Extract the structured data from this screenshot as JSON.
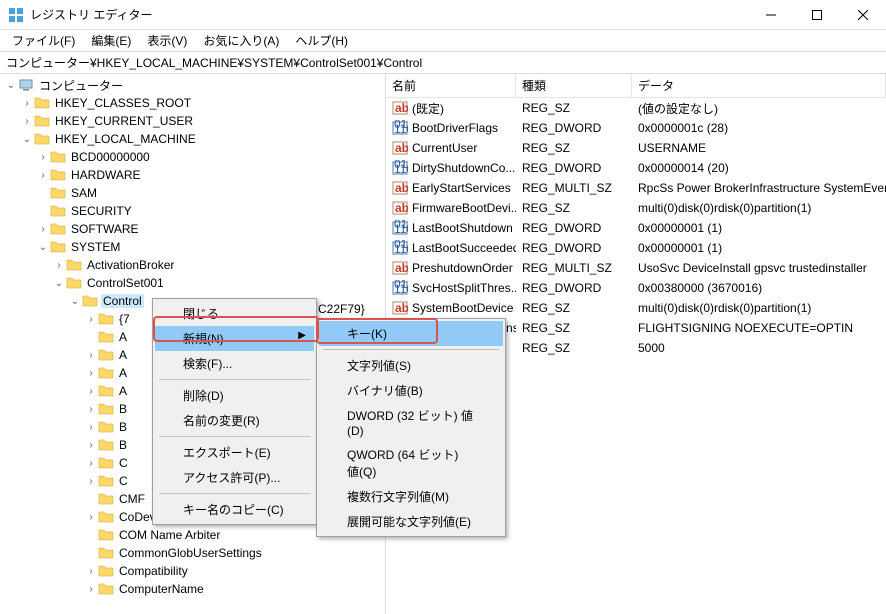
{
  "window": {
    "title": "レジストリ エディター"
  },
  "menubar": {
    "file": "ファイル(F)",
    "edit": "編集(E)",
    "view": "表示(V)",
    "favorites": "お気に入り(A)",
    "help": "ヘルプ(H)"
  },
  "address": "コンピューター¥HKEY_LOCAL_MACHINE¥SYSTEM¥ControlSet001¥Control",
  "columns": {
    "name": "名前",
    "type": "種類",
    "data": "データ"
  },
  "tree": [
    {
      "level": 0,
      "exp": "v",
      "icon": "pc",
      "label": "コンピューター"
    },
    {
      "level": 1,
      "exp": ">",
      "icon": "folder",
      "label": "HKEY_CLASSES_ROOT"
    },
    {
      "level": 1,
      "exp": ">",
      "icon": "folder",
      "label": "HKEY_CURRENT_USER"
    },
    {
      "level": 1,
      "exp": "v",
      "icon": "folder",
      "label": "HKEY_LOCAL_MACHINE"
    },
    {
      "level": 2,
      "exp": ">",
      "icon": "folder",
      "label": "BCD00000000"
    },
    {
      "level": 2,
      "exp": ">",
      "icon": "folder",
      "label": "HARDWARE"
    },
    {
      "level": 2,
      "exp": "",
      "icon": "folder",
      "label": "SAM"
    },
    {
      "level": 2,
      "exp": "",
      "icon": "folder",
      "label": "SECURITY"
    },
    {
      "level": 2,
      "exp": ">",
      "icon": "folder",
      "label": "SOFTWARE"
    },
    {
      "level": 2,
      "exp": "v",
      "icon": "folder",
      "label": "SYSTEM"
    },
    {
      "level": 3,
      "exp": ">",
      "icon": "folder",
      "label": "ActivationBroker"
    },
    {
      "level": 3,
      "exp": "v",
      "icon": "folder",
      "label": "ControlSet001"
    },
    {
      "level": 4,
      "exp": "v",
      "icon": "folder",
      "label": "Control",
      "selected": true
    },
    {
      "level": 5,
      "exp": ">",
      "icon": "folder",
      "label": "{7"
    },
    {
      "level": 5,
      "exp": "",
      "icon": "folder",
      "label": "A"
    },
    {
      "level": 5,
      "exp": ">",
      "icon": "folder",
      "label": "A"
    },
    {
      "level": 5,
      "exp": ">",
      "icon": "folder",
      "label": "A"
    },
    {
      "level": 5,
      "exp": ">",
      "icon": "folder",
      "label": "A"
    },
    {
      "level": 5,
      "exp": ">",
      "icon": "folder",
      "label": "B"
    },
    {
      "level": 5,
      "exp": ">",
      "icon": "folder",
      "label": "B"
    },
    {
      "level": 5,
      "exp": ">",
      "icon": "folder",
      "label": "B"
    },
    {
      "level": 5,
      "exp": ">",
      "icon": "folder",
      "label": "C"
    },
    {
      "level": 5,
      "exp": ">",
      "icon": "folder",
      "label": "C"
    },
    {
      "level": 5,
      "exp": "",
      "icon": "folder",
      "label": "CMF"
    },
    {
      "level": 5,
      "exp": ">",
      "icon": "folder",
      "label": "CoDeviceInstallers"
    },
    {
      "level": 5,
      "exp": "",
      "icon": "folder",
      "label": "COM Name Arbiter"
    },
    {
      "level": 5,
      "exp": "",
      "icon": "folder",
      "label": "CommonGlobUserSettings"
    },
    {
      "level": 5,
      "exp": ">",
      "icon": "folder",
      "label": "Compatibility"
    },
    {
      "level": 5,
      "exp": ">",
      "icon": "folder",
      "label": "ComputerName"
    }
  ],
  "values": [
    {
      "icon": "sz",
      "name": "(既定)",
      "type": "REG_SZ",
      "data": "(値の設定なし)"
    },
    {
      "icon": "bin",
      "name": "BootDriverFlags",
      "type": "REG_DWORD",
      "data": "0x0000001c (28)"
    },
    {
      "icon": "sz",
      "name": "CurrentUser",
      "type": "REG_SZ",
      "data": "USERNAME"
    },
    {
      "icon": "bin",
      "name": "DirtyShutdownCo...",
      "type": "REG_DWORD",
      "data": "0x00000014 (20)"
    },
    {
      "icon": "sz",
      "name": "EarlyStartServices",
      "type": "REG_MULTI_SZ",
      "data": "RpcSs Power BrokerInfrastructure SystemEvents"
    },
    {
      "icon": "sz",
      "name": "FirmwareBootDevi...",
      "type": "REG_SZ",
      "data": "multi(0)disk(0)rdisk(0)partition(1)"
    },
    {
      "icon": "bin",
      "name": "LastBootShutdown",
      "type": "REG_DWORD",
      "data": "0x00000001 (1)"
    },
    {
      "icon": "bin",
      "name": "LastBootSucceeded",
      "type": "REG_DWORD",
      "data": "0x00000001 (1)"
    },
    {
      "icon": "sz",
      "name": "PreshutdownOrder",
      "type": "REG_MULTI_SZ",
      "data": "UsoSvc DeviceInstall gpsvc trustedinstaller"
    },
    {
      "icon": "bin",
      "name": "SvcHostSplitThres...",
      "type": "REG_DWORD",
      "data": "0x00380000 (3670016)"
    },
    {
      "icon": "sz",
      "name": "SystemBootDevice",
      "type": "REG_SZ",
      "data": "multi(0)disk(0)rdisk(0)partition(1)"
    },
    {
      "icon": "sz",
      "name": "SystemStartOptions",
      "type": "REG_SZ",
      "data": " FLIGHTSIGNING  NOEXECUTE=OPTIN"
    },
    {
      "icon": "sz",
      "name": "",
      "type": "REG_SZ",
      "data": "5000"
    }
  ],
  "contextMenu1": {
    "close": "閉じる",
    "new": "新規(N)",
    "find": "検索(F)...",
    "delete": "削除(D)",
    "rename": "名前の変更(R)",
    "export": "エクスポート(E)",
    "permissions": "アクセス許可(P)...",
    "copyKeyName": "キー名のコピー(C)"
  },
  "contextMenu2": {
    "key": "キー(K)",
    "string": "文字列値(S)",
    "binary": "バイナリ値(B)",
    "dword": "DWORD (32 ビット) 値(D)",
    "qword": "QWORD (64 ビット) 値(Q)",
    "multi": "複数行文字列値(M)",
    "expand": "展開可能な文字列値(E)"
  },
  "truncatedTreeLabel": "C22F79}"
}
